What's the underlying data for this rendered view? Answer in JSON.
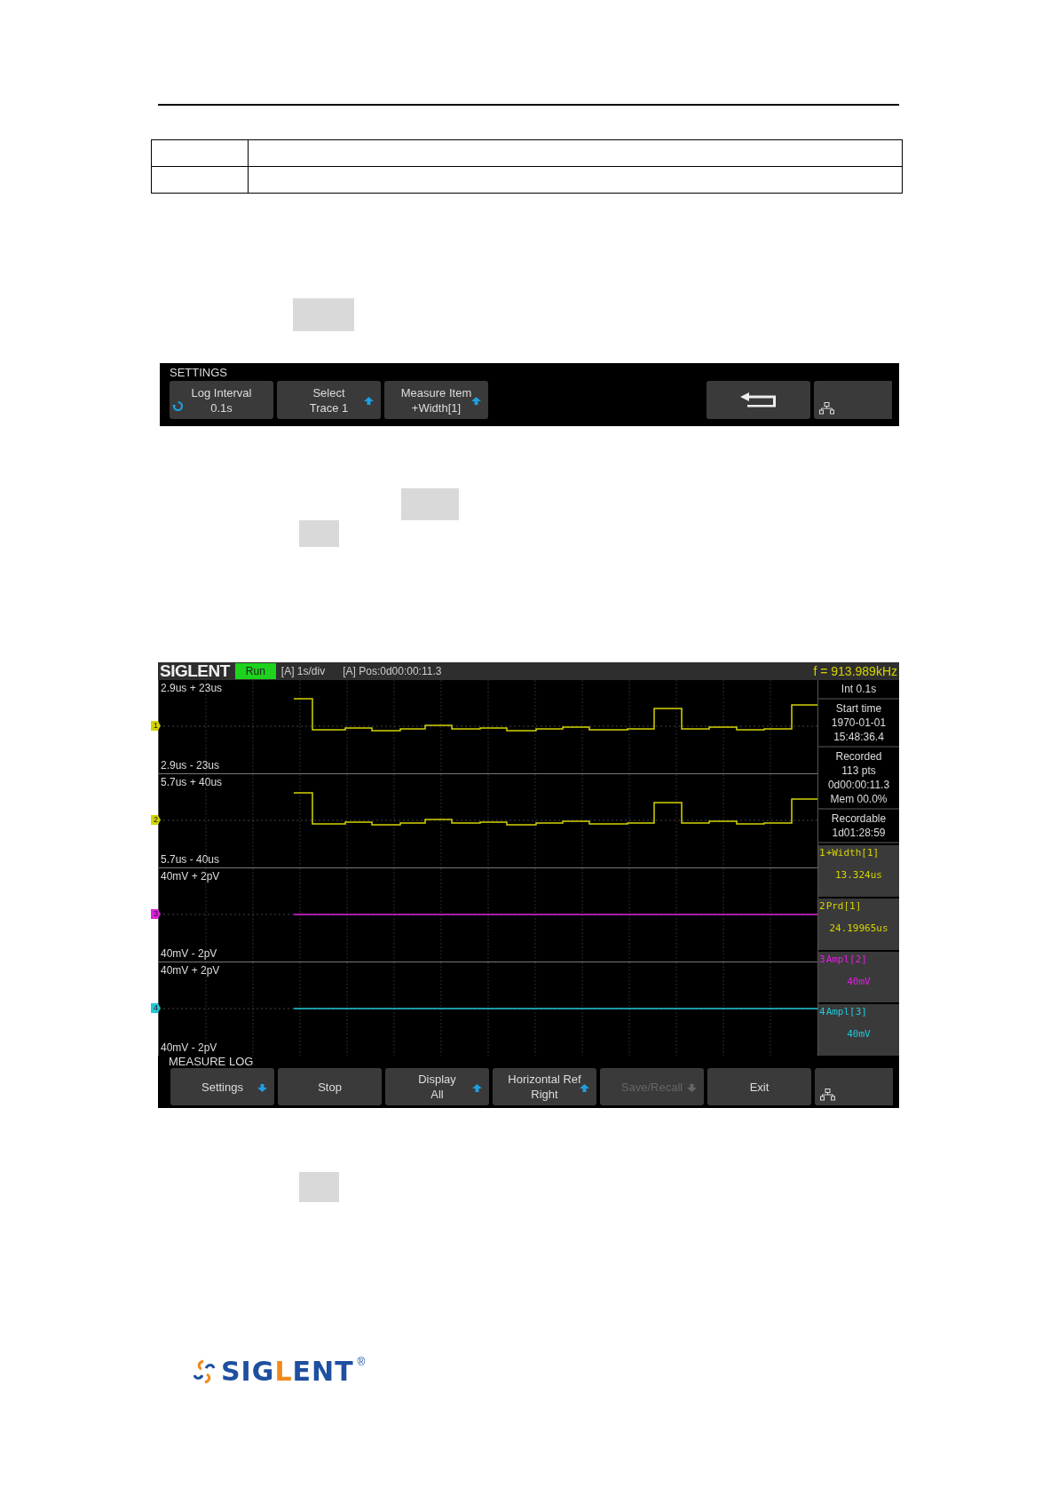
{
  "settings_bar": {
    "title": "SETTINGS",
    "buttons": [
      {
        "kind": "rotate",
        "lines": [
          "Log Interval",
          "0.1s"
        ],
        "disabled": false
      },
      {
        "kind": "up",
        "lines": [
          "Select",
          "Trace 1"
        ],
        "disabled": false
      },
      {
        "kind": "up",
        "lines": [
          "Measure Item",
          "+Width[1]"
        ],
        "disabled": false
      },
      {
        "kind": "empty"
      },
      {
        "kind": "empty"
      },
      {
        "kind": "back"
      },
      {
        "kind": "network"
      }
    ]
  },
  "scope": {
    "brand": "SIGLENT",
    "run_state": "Run",
    "timebase": "[A] 1s/div",
    "position": "[A] Pos:0d00:00:11.3",
    "frequency": "f = 913.989kHz",
    "traces": [
      {
        "channel": "1",
        "color": "#d4d400",
        "kind": "step",
        "top": "2.9us + 23us",
        "bottom": "2.9us - 23us"
      },
      {
        "channel": "2",
        "color": "#d4d400",
        "kind": "step",
        "top": "5.7us + 40us",
        "bottom": "5.7us - 40us"
      },
      {
        "channel": "3",
        "color": "#e020e0",
        "kind": "flat",
        "top": "40mV + 2pV",
        "bottom": "40mV - 2pV"
      },
      {
        "channel": "4",
        "color": "#20c8d8",
        "kind": "flat",
        "top": "40mV + 2pV",
        "bottom": "40mV - 2pV"
      }
    ],
    "info": [
      [
        "Int 0.1s"
      ],
      [
        "Start time",
        "1970-01-01",
        "15:48:36.4"
      ],
      [
        "Recorded",
        "113 pts",
        "0d00:00:11.3",
        "Mem 00.0%"
      ],
      [
        "Recordable",
        "1d01:28:59"
      ]
    ],
    "measurements": [
      {
        "channel": "1",
        "name": "+Width[1]",
        "value": "13.324us",
        "color": "#d4d400"
      },
      {
        "channel": "2",
        "name": "Prd[1]",
        "value": "24.19965us",
        "color": "#d4d400"
      },
      {
        "channel": "3",
        "name": "Ampl[2]",
        "value": "40mV",
        "color": "#e020e0"
      },
      {
        "channel": "4",
        "name": "Ampl[3]",
        "value": "40mV",
        "color": "#20c8d8"
      }
    ],
    "menu_title": "MEASURE LOG",
    "buttons": [
      {
        "kind": "down",
        "lines": [
          "Settings"
        ],
        "disabled": false
      },
      {
        "kind": "plain",
        "lines": [
          "Stop"
        ],
        "disabled": false
      },
      {
        "kind": "up",
        "lines": [
          "Display",
          "All"
        ],
        "disabled": false
      },
      {
        "kind": "up",
        "lines": [
          "Horizontal Ref",
          "Right"
        ],
        "disabled": false
      },
      {
        "kind": "down",
        "lines": [
          "Save/Recall"
        ],
        "disabled": true
      },
      {
        "kind": "plain",
        "lines": [
          "Exit"
        ],
        "disabled": false
      },
      {
        "kind": "network"
      }
    ]
  },
  "footer_logo": {
    "parts": [
      {
        "text": "SIG",
        "accent": false
      },
      {
        "text": "L",
        "accent": true
      },
      {
        "text": "ENT",
        "accent": false
      }
    ],
    "mark": "®"
  }
}
